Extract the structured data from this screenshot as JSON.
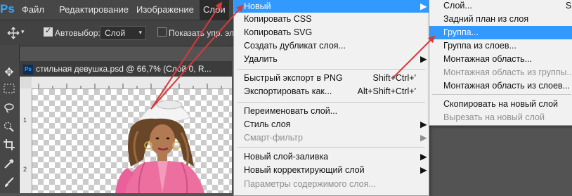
{
  "app": {
    "logo": "Ps",
    "menubar": [
      "Файл",
      "Редактирование",
      "Изображение",
      "Слои"
    ],
    "options": {
      "autoselect_label": "Автовыбор:",
      "autoselect_value": "Слой",
      "show_controls_label": "Показать упр. элем"
    },
    "tools": [
      "move-icon",
      "marquee-icon",
      "lasso-icon",
      "quick-select-icon",
      "crop-icon",
      "eyedropper-icon",
      "brush-icon"
    ]
  },
  "document": {
    "tab_badge": "Ps",
    "tab_title": "стильная девушка.psd @ 66,7% (Слой 0, R...",
    "ruler_left_marks": [
      "1",
      "2"
    ]
  },
  "layer_menu": {
    "items": [
      {
        "label": "Новый",
        "submenu": true,
        "highlighted": true
      },
      {
        "label": "Копировать CSS"
      },
      {
        "label": "Копировать SVG"
      },
      {
        "label": "Создать дубликат слоя..."
      },
      {
        "label": "Удалить",
        "submenu": true
      },
      {
        "label": "Быстрый экспорт в PNG",
        "shortcut": "Shift+Ctrl+'"
      },
      {
        "label": "Экспортировать как...",
        "shortcut": "Alt+Shift+Ctrl+'"
      },
      {
        "label": "Переименовать слой..."
      },
      {
        "label": "Стиль слоя",
        "submenu": true
      },
      {
        "label": "Смарт-фильтр",
        "disabled": true,
        "submenu": true
      },
      {
        "label": "Новый слой-заливка",
        "submenu": true
      },
      {
        "label": "Новый корректирующий слой",
        "submenu": true
      },
      {
        "label": "Параметры содержимого слоя...",
        "disabled": true
      }
    ]
  },
  "new_submenu": {
    "items": [
      {
        "label": "Слой...",
        "shortcut": "Shi"
      },
      {
        "label": "Задний план из слоя"
      },
      {
        "label": "Группа...",
        "highlighted": true
      },
      {
        "label": "Группа из слоев..."
      },
      {
        "label": "Монтажная область..."
      },
      {
        "label": "Монтажная область из группы...",
        "disabled": true
      },
      {
        "label": "Монтажная область из слоев..."
      },
      {
        "label": "Скопировать на новый слой"
      },
      {
        "label": "Вырезать на новый слой",
        "disabled": true
      }
    ]
  },
  "colors": {
    "highlight": "#3199ff",
    "arrow": "#d83a3a",
    "ps_blue": "#31a8ff"
  }
}
